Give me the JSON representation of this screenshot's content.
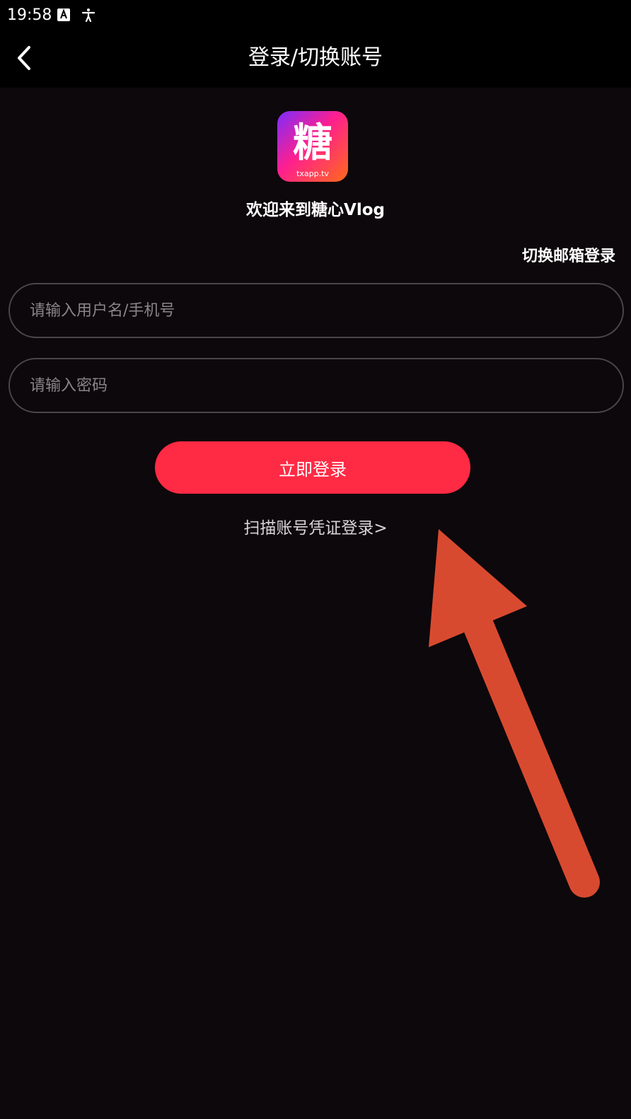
{
  "status_bar": {
    "time": "19:58",
    "icons": [
      "font-a-icon",
      "accessibility-icon"
    ]
  },
  "nav": {
    "title": "登录/切换账号",
    "back_icon": "chevron-left-icon"
  },
  "logo": {
    "glyph": "糖",
    "caption": "txapp.tv"
  },
  "welcome_text": "欢迎来到糖心Vlog",
  "switch_email_label": "切换邮箱登录",
  "form": {
    "username_placeholder": "请输入用户名/手机号",
    "username_value": "",
    "password_placeholder": "请输入密码",
    "password_value": ""
  },
  "login_button_label": "立即登录",
  "scan_link_label": "扫描账号凭证登录>",
  "colors": {
    "background": "#0d080b",
    "bar": "#000000",
    "accent": "#ff2a44",
    "field_border": "#4a4549",
    "annotation_arrow": "#d84a30"
  }
}
